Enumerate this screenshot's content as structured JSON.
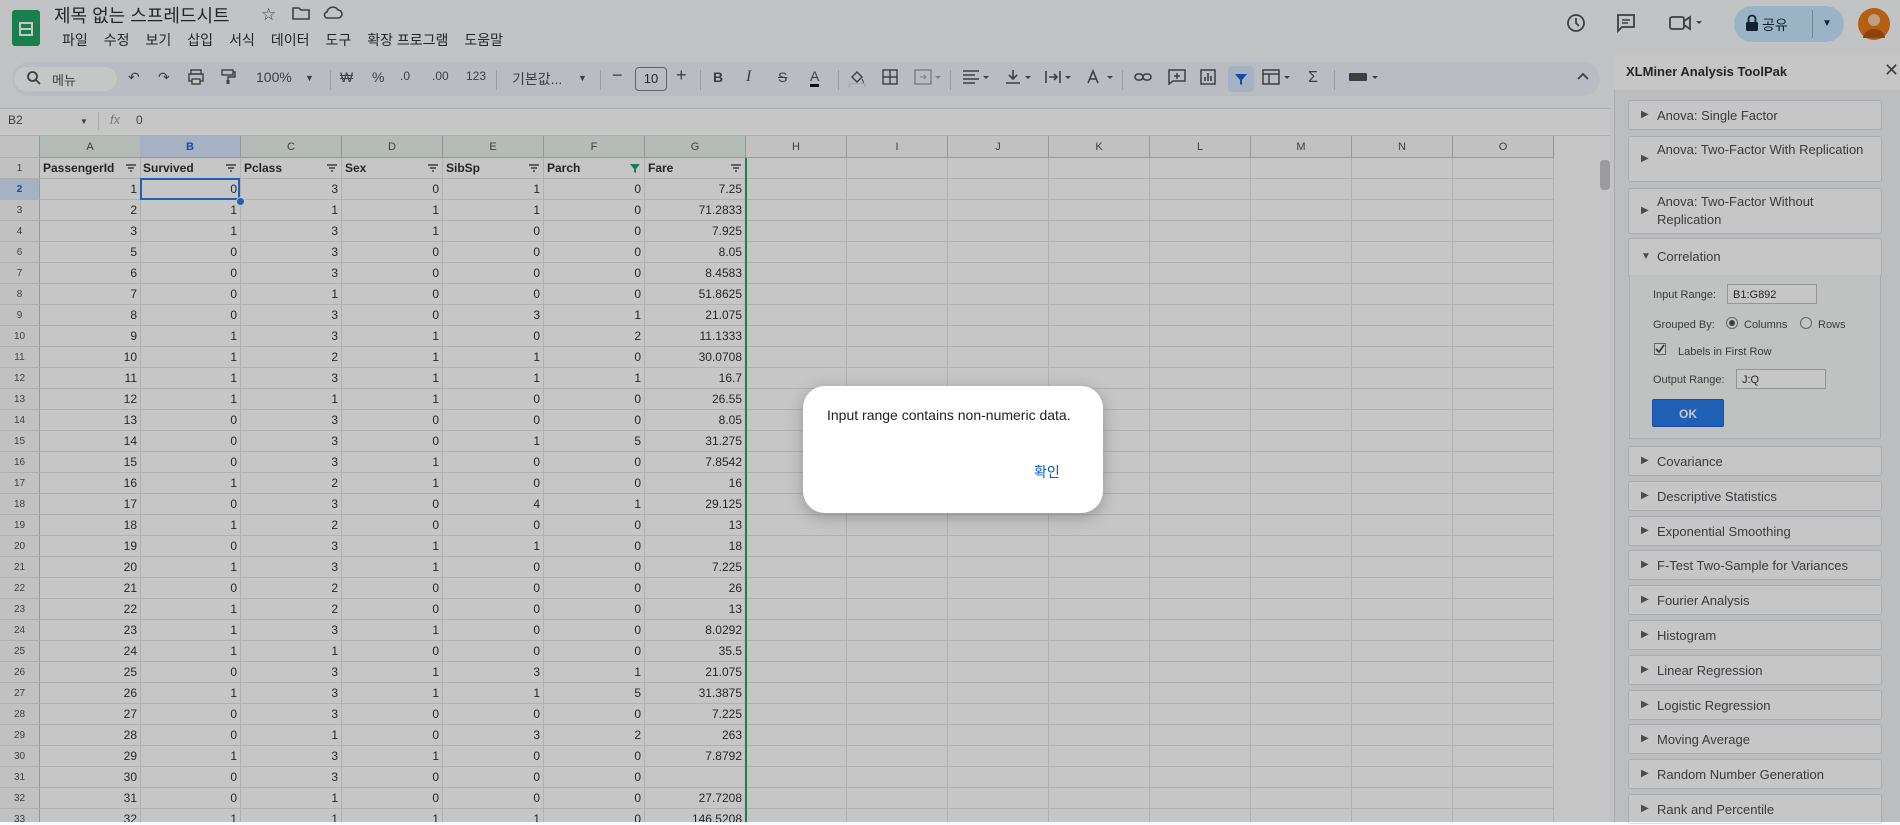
{
  "app": {
    "doc_title": "제목 없는 스프레드시트",
    "menus": [
      "파일",
      "수정",
      "보기",
      "삽입",
      "서식",
      "데이터",
      "도구",
      "확장 프로그램",
      "도움말"
    ],
    "share_label": "공유"
  },
  "toolbar": {
    "search_placeholder": "메뉴",
    "zoom": "100%",
    "currency": "₩",
    "percent": "%",
    "decrease_decimal": ".0",
    "increase_decimal": ".00",
    "number_format": "123",
    "font_name": "기본값...",
    "font_size": "10",
    "bold": "B",
    "italic": "I",
    "strike": "S",
    "text_color": "A",
    "sum": "Σ"
  },
  "formula_bar": {
    "name_box": "B2",
    "fx": "fx",
    "value": "0"
  },
  "grid": {
    "columns": [
      "A",
      "B",
      "C",
      "D",
      "E",
      "F",
      "G",
      "H",
      "I",
      "J",
      "K",
      "L",
      "M",
      "N",
      "O"
    ],
    "header_row": [
      "PassengerId",
      "Survived",
      "Pclass",
      "Sex",
      "SibSp",
      "Parch",
      "Fare"
    ],
    "row_numbers": [
      "1",
      "2",
      "3",
      "4",
      "6",
      "7",
      "8",
      "9",
      "10",
      "11",
      "12",
      "13",
      "14",
      "15",
      "16",
      "17",
      "18",
      "19",
      "20",
      "21",
      "22",
      "23",
      "24",
      "25",
      "26",
      "27",
      "28",
      "29",
      "30",
      "31",
      "32",
      "33"
    ],
    "rows": [
      [
        "1",
        "0",
        "3",
        "0",
        "1",
        "0",
        "7.25"
      ],
      [
        "2",
        "1",
        "1",
        "1",
        "1",
        "0",
        "71.2833"
      ],
      [
        "3",
        "1",
        "3",
        "1",
        "0",
        "0",
        "7.925"
      ],
      [
        "5",
        "0",
        "3",
        "0",
        "0",
        "0",
        "8.05"
      ],
      [
        "6",
        "0",
        "3",
        "0",
        "0",
        "0",
        "8.4583"
      ],
      [
        "7",
        "0",
        "1",
        "0",
        "0",
        "0",
        "51.8625"
      ],
      [
        "8",
        "0",
        "3",
        "0",
        "3",
        "1",
        "21.075"
      ],
      [
        "9",
        "1",
        "3",
        "1",
        "0",
        "2",
        "11.1333"
      ],
      [
        "10",
        "1",
        "2",
        "1",
        "1",
        "0",
        "30.0708"
      ],
      [
        "11",
        "1",
        "3",
        "1",
        "1",
        "1",
        "16.7"
      ],
      [
        "12",
        "1",
        "1",
        "1",
        "0",
        "0",
        "26.55"
      ],
      [
        "13",
        "0",
        "3",
        "0",
        "0",
        "0",
        "8.05"
      ],
      [
        "14",
        "0",
        "3",
        "0",
        "1",
        "5",
        "31.275"
      ],
      [
        "15",
        "0",
        "3",
        "1",
        "0",
        "0",
        "7.8542"
      ],
      [
        "16",
        "1",
        "2",
        "1",
        "0",
        "0",
        "16"
      ],
      [
        "17",
        "0",
        "3",
        "0",
        "4",
        "1",
        "29.125"
      ],
      [
        "18",
        "1",
        "2",
        "0",
        "0",
        "0",
        "13"
      ],
      [
        "19",
        "0",
        "3",
        "1",
        "1",
        "0",
        "18"
      ],
      [
        "20",
        "1",
        "3",
        "1",
        "0",
        "0",
        "7.225"
      ],
      [
        "21",
        "0",
        "2",
        "0",
        "0",
        "0",
        "26"
      ],
      [
        "22",
        "1",
        "2",
        "0",
        "0",
        "0",
        "13"
      ],
      [
        "23",
        "1",
        "3",
        "1",
        "0",
        "0",
        "8.0292"
      ],
      [
        "24",
        "1",
        "1",
        "0",
        "0",
        "0",
        "35.5"
      ],
      [
        "25",
        "0",
        "3",
        "1",
        "3",
        "1",
        "21.075"
      ],
      [
        "26",
        "1",
        "3",
        "1",
        "1",
        "5",
        "31.3875"
      ],
      [
        "27",
        "0",
        "3",
        "0",
        "0",
        "0",
        "7.225"
      ],
      [
        "28",
        "0",
        "1",
        "0",
        "3",
        "2",
        "263"
      ],
      [
        "29",
        "1",
        "3",
        "1",
        "0",
        "0",
        "7.8792"
      ],
      [
        "30",
        "0",
        "3",
        "0",
        "0",
        "0",
        ""
      ],
      [
        "31",
        "0",
        "1",
        "0",
        "0",
        "0",
        "27.7208"
      ],
      [
        "32",
        "1",
        "1",
        "1",
        "1",
        "0",
        "146.5208"
      ]
    ]
  },
  "panel": {
    "title": "XLMiner Analysis ToolPak",
    "tools_before": [
      "Anova: Single Factor",
      "Anova: Two-Factor With Replication",
      "Anova: Two-Factor Without Replication"
    ],
    "expanded_tool": "Correlation",
    "input_range_label": "Input Range:",
    "input_range_value": "B1:G892",
    "grouped_by_label": "Grouped By:",
    "columns_label": "Columns",
    "rows_label": "Rows",
    "labels_first_row": "Labels in First Row",
    "output_range_label": "Output Range:",
    "output_range_value": "J:Q",
    "ok_label": "OK",
    "tools_after": [
      "Covariance",
      "Descriptive Statistics",
      "Exponential Smoothing",
      "F-Test Two-Sample for Variances",
      "Fourier Analysis",
      "Histogram",
      "Linear Regression",
      "Logistic Regression",
      "Moving Average",
      "Random Number Generation",
      "Rank and Percentile"
    ]
  },
  "dialog": {
    "message": "Input range contains non-numeric data.",
    "confirm": "확인"
  },
  "colors": {
    "accent": "#1a73e8",
    "sheets_green": "#0f9d58",
    "share_bg": "#c2e7ff",
    "overlay": "rgba(50,50,50,0.28)"
  }
}
